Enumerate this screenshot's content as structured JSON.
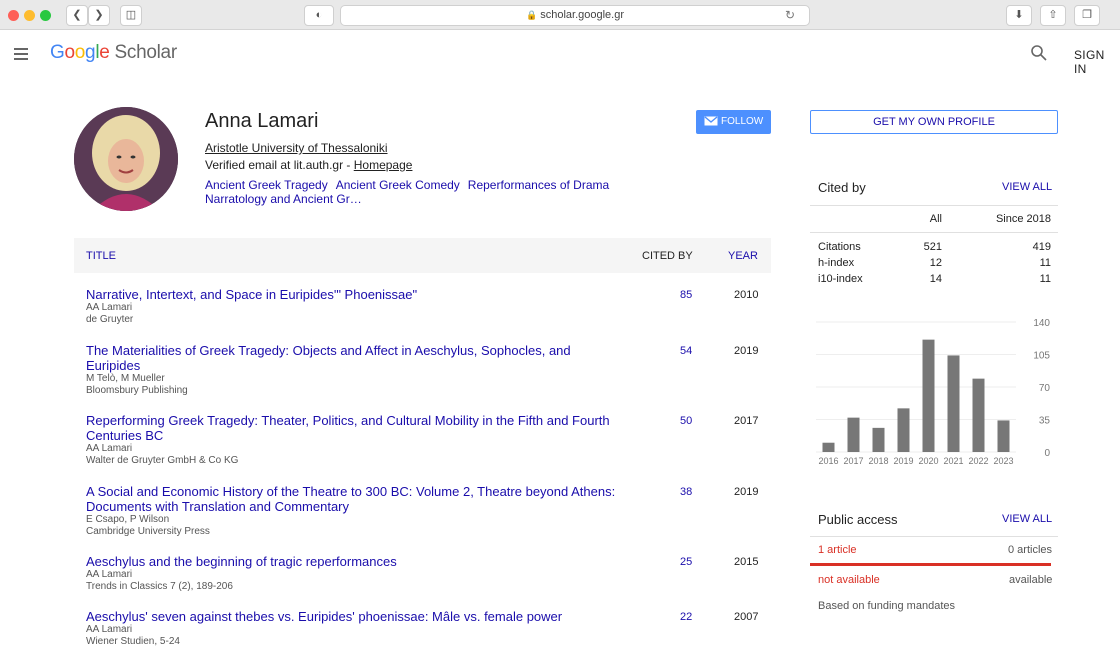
{
  "browser": {
    "url": "scholar.google.gr"
  },
  "header": {
    "logo_google": "Google",
    "logo_scholar": "Scholar",
    "sign_in": "SIGN IN"
  },
  "profile": {
    "name": "Anna Lamari",
    "affiliation": "Aristotle University of Thessaloniki",
    "email_prefix": "Verified email at lit.auth.gr - ",
    "homepage": "Homepage",
    "interests": [
      "Ancient Greek Tragedy",
      "Ancient Greek Comedy",
      "Reperformances of Drama",
      "Narratology and Ancient Gr…"
    ],
    "follow": "FOLLOW"
  },
  "table": {
    "col_title": "TITLE",
    "col_cited": "CITED BY",
    "col_year": "YEAR",
    "rows": [
      {
        "title": "Narrative, Intertext, and Space in Euripides'\" Phoenissae\"",
        "authors": "AA Lamari",
        "venue": "de Gruyter",
        "cited": "85",
        "year": "2010"
      },
      {
        "title": "The Materialities of Greek Tragedy: Objects and Affect in Aeschylus, Sophocles, and Euripides",
        "authors": "M Telò, M Mueller",
        "venue": "Bloomsbury Publishing",
        "cited": "54",
        "year": "2019"
      },
      {
        "title": "Reperforming Greek Tragedy: Theater, Politics, and Cultural Mobility in the Fifth and Fourth Centuries BC",
        "authors": "AA Lamari",
        "venue": "Walter de Gruyter GmbH & Co KG",
        "cited": "50",
        "year": "2017"
      },
      {
        "title": "A Social and Economic History of the Theatre to 300 BC: Volume 2, Theatre beyond Athens: Documents with Translation and Commentary",
        "authors": "E Csapo, P Wilson",
        "venue": "Cambridge University Press",
        "cited": "38",
        "year": "2019"
      },
      {
        "title": "Aeschylus and the beginning of tragic reperformances",
        "authors": "AA Lamari",
        "venue": "Trends in Classics 7 (2), 189-206",
        "cited": "25",
        "year": "2015"
      },
      {
        "title": "Aeschylus' seven against thebes vs. Euripides' phoenissae: Mâle vs. female power",
        "authors": "AA Lamari",
        "venue": "Wiener Studien, 5-24",
        "cited": "22",
        "year": "2007"
      }
    ]
  },
  "sidebar": {
    "get_profile": "GET MY OWN PROFILE",
    "cited_by": "Cited by",
    "view_all": "VIEW ALL",
    "col_all": "All",
    "col_since": "Since 2018",
    "stats": [
      {
        "label": "Citations",
        "all": "521",
        "since": "419"
      },
      {
        "label": "h-index",
        "all": "12",
        "since": "11"
      },
      {
        "label": "i10-index",
        "all": "14",
        "since": "11"
      }
    ],
    "public_access": "Public access",
    "pa_view_all": "VIEW ALL",
    "pa_articles": "1 article",
    "pa_zero": "0 articles",
    "pa_not_available": "not available",
    "pa_available": "available",
    "pa_note": "Based on funding mandates"
  },
  "chart_data": {
    "type": "bar",
    "categories": [
      "2016",
      "2017",
      "2018",
      "2019",
      "2020",
      "2021",
      "2022",
      "2023"
    ],
    "values": [
      10,
      37,
      26,
      47,
      121,
      104,
      79,
      34
    ],
    "yticks": [
      "0",
      "35",
      "70",
      "105",
      "140"
    ],
    "ylim": [
      0,
      140
    ],
    "color": "#777777"
  }
}
